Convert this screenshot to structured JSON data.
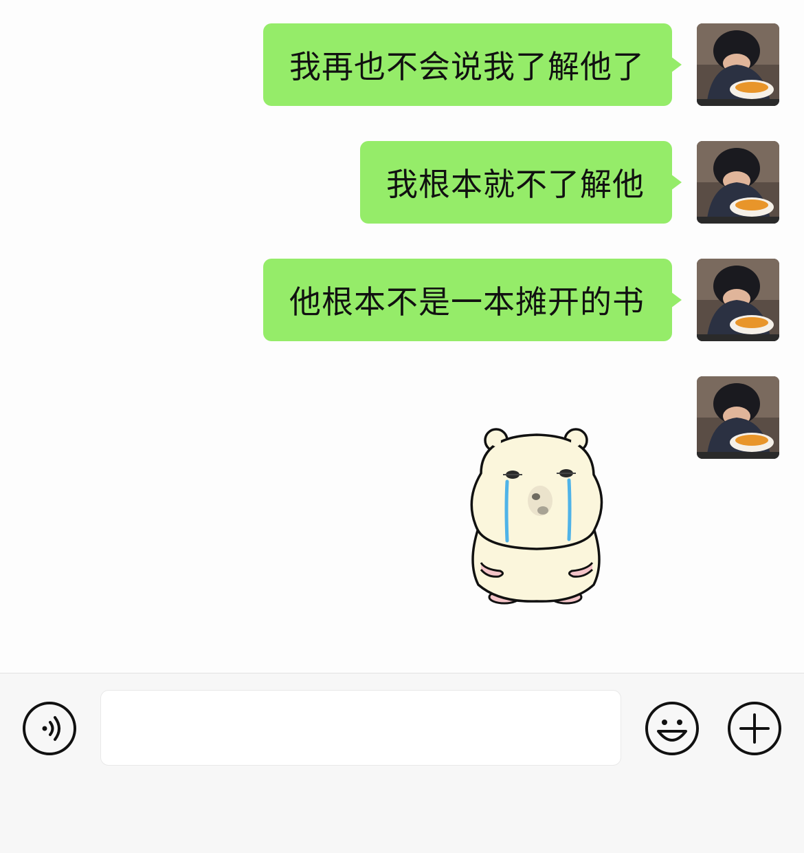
{
  "chat": {
    "messages": [
      {
        "sender": "self",
        "type": "text",
        "text": "我再也不会说我了解他了"
      },
      {
        "sender": "self",
        "type": "text",
        "text": "我根本就不了解他"
      },
      {
        "sender": "self",
        "type": "text",
        "text": "他根本不是一本摊开的书"
      },
      {
        "sender": "self",
        "type": "sticker",
        "sticker": "crying-hamster"
      }
    ]
  },
  "input_bar": {
    "voice_icon": "voice-icon",
    "input_value": "",
    "emoji_icon": "emoji-icon",
    "plus_icon": "plus-icon"
  },
  "colors": {
    "bubble_self": "#95ec69",
    "chat_background": "#fdfdfd",
    "input_bar_background": "#f7f7f7"
  }
}
